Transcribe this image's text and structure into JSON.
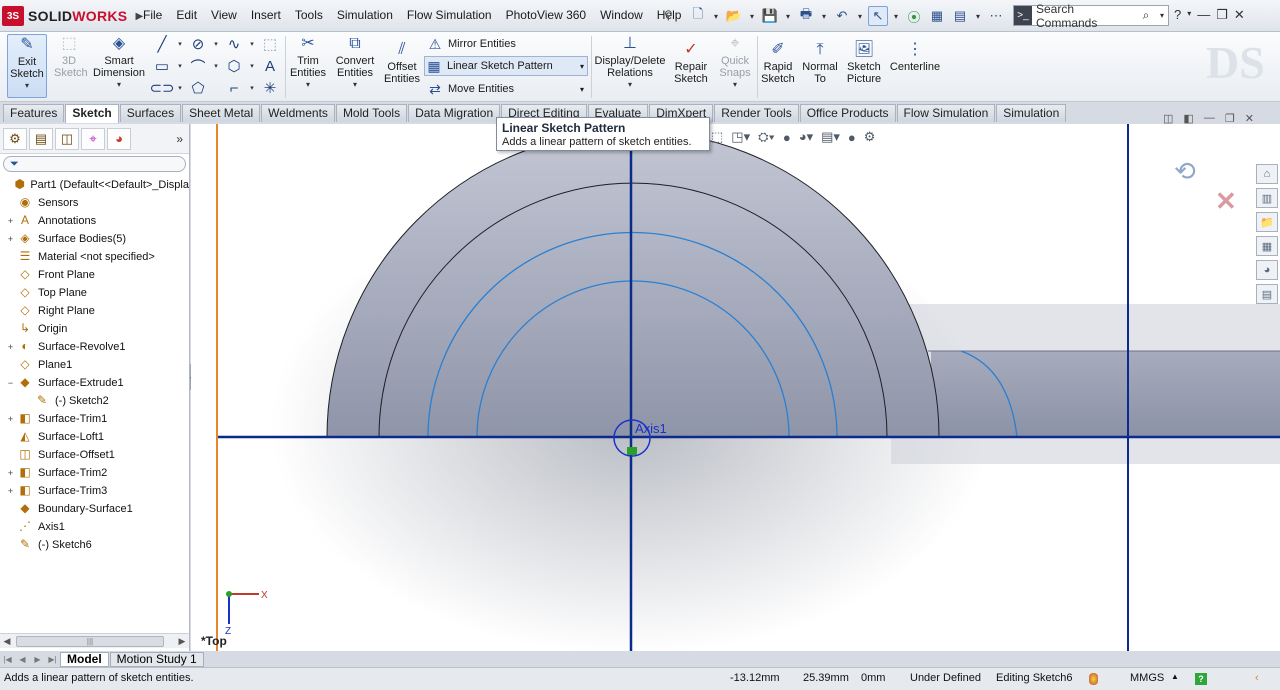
{
  "app": {
    "logo_ds": "3S",
    "brand_a": "SOLID",
    "brand_b": "WORKS",
    "menus": [
      "File",
      "Edit",
      "View",
      "Insert",
      "Tools",
      "Simulation",
      "Flow Simulation",
      "PhotoView 360",
      "Window",
      "Help"
    ],
    "search_placeholder": "Search Commands"
  },
  "ribbon": {
    "exit_sketch": "Exit Sketch",
    "sketch_3d": "3D Sketch",
    "smart_dimension": "Smart Dimension",
    "trim_entities": "Trim Entities",
    "convert_entities": "Convert Entities",
    "offset_entities": "Offset Entities",
    "mirror_entities": "Mirror Entities",
    "linear_sketch_pattern": "Linear Sketch Pattern",
    "move_entities": "Move Entities",
    "display_delete_relations": "Display/Delete Relations",
    "repair_sketch": "Repair Sketch",
    "quick_snaps": "Quick Snaps",
    "rapid_sketch": "Rapid Sketch",
    "normal_to": "Normal To",
    "sketch_picture": "Sketch Picture",
    "centerline": "Centerline"
  },
  "tabs": [
    "Features",
    "Sketch",
    "Surfaces",
    "Sheet Metal",
    "Weldments",
    "Mold Tools",
    "Data Migration",
    "Direct Editing",
    "Evaluate",
    "DimXpert",
    "Render Tools",
    "Office Products",
    "Flow Simulation",
    "Simulation"
  ],
  "active_tab": "Sketch",
  "tree": [
    {
      "label": "Part1  (Default<<Default>_Displa",
      "icon": "part-icon",
      "expand": "",
      "child": false
    },
    {
      "label": "Sensors",
      "icon": "sensors-icon",
      "expand": "",
      "child": false
    },
    {
      "label": "Annotations",
      "icon": "annotations-icon",
      "expand": "+",
      "child": false
    },
    {
      "label": "Surface Bodies(5)",
      "icon": "surface-bodies-icon",
      "expand": "+",
      "child": false
    },
    {
      "label": "Material <not specified>",
      "icon": "material-icon",
      "expand": "",
      "child": false
    },
    {
      "label": "Front Plane",
      "icon": "plane-icon",
      "expand": "",
      "child": false
    },
    {
      "label": "Top Plane",
      "icon": "plane-icon",
      "expand": "",
      "child": false
    },
    {
      "label": "Right Plane",
      "icon": "plane-icon",
      "expand": "",
      "child": false
    },
    {
      "label": "Origin",
      "icon": "origin-icon",
      "expand": "",
      "child": false
    },
    {
      "label": "Surface-Revolve1",
      "icon": "surface-revolve-icon",
      "expand": "+",
      "child": false
    },
    {
      "label": "Plane1",
      "icon": "plane-icon",
      "expand": "",
      "child": false
    },
    {
      "label": "Surface-Extrude1",
      "icon": "surface-extrude-icon",
      "expand": "−",
      "child": false
    },
    {
      "label": "(-) Sketch2",
      "icon": "sketch-icon",
      "expand": "",
      "child": true
    },
    {
      "label": "Surface-Trim1",
      "icon": "surface-trim-icon",
      "expand": "+",
      "child": false
    },
    {
      "label": "Surface-Loft1",
      "icon": "surface-loft-icon",
      "expand": "",
      "child": false
    },
    {
      "label": "Surface-Offset1",
      "icon": "surface-offset-icon",
      "expand": "",
      "child": false
    },
    {
      "label": "Surface-Trim2",
      "icon": "surface-trim-icon",
      "expand": "+",
      "child": false
    },
    {
      "label": "Surface-Trim3",
      "icon": "surface-trim-icon",
      "expand": "+",
      "child": false
    },
    {
      "label": "Boundary-Surface1",
      "icon": "boundary-surface-icon",
      "expand": "",
      "child": false
    },
    {
      "label": "Axis1",
      "icon": "axis-icon",
      "expand": "",
      "child": false
    },
    {
      "label": "(-) Sketch6",
      "icon": "sketch-icon",
      "expand": "",
      "child": false
    }
  ],
  "viewport": {
    "view_name": "*Top",
    "axis_label": "Axis1"
  },
  "tooltip": {
    "title": "Linear Sketch Pattern",
    "description": "Adds a linear pattern of sketch entities."
  },
  "bottom_tabs": [
    "Model",
    "Motion Study 1"
  ],
  "status": {
    "message": "Adds a linear pattern of sketch entities.",
    "x": "-13.12mm",
    "y": "25.39mm",
    "z": "0mm",
    "state": "Under Defined",
    "editing": "Editing Sketch6",
    "units": "MMGS"
  },
  "colors": {
    "sketch_blue": "#0a2a8c",
    "sketch_arc": "#2b7fd0",
    "origin_orange": "#e8862a",
    "body_gray": "#9aa0b4"
  }
}
